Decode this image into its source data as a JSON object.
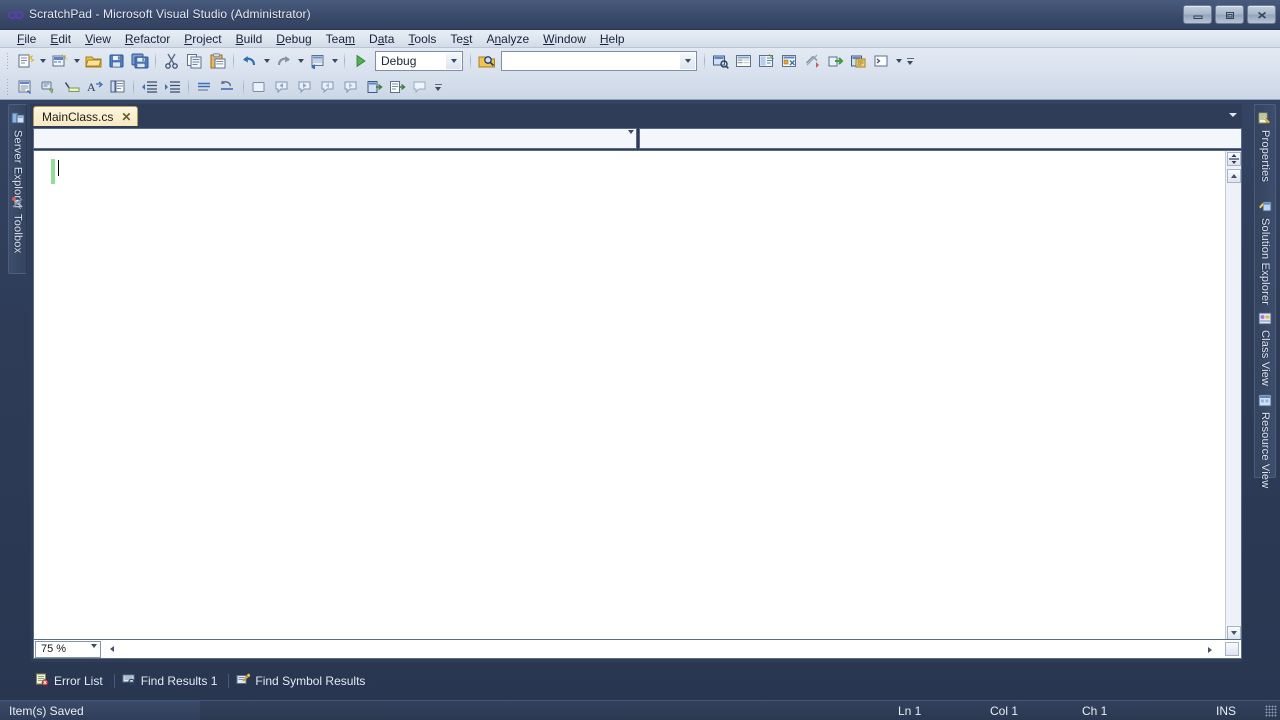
{
  "window": {
    "title": "ScratchPad - Microsoft Visual Studio (Administrator)",
    "app_icon": "visual-studio-icon",
    "controls": {
      "minimize": "Minimize",
      "restore": "Restore",
      "close": "Close"
    }
  },
  "menubar": {
    "items": [
      {
        "label": "File",
        "accel": "F"
      },
      {
        "label": "Edit",
        "accel": "E"
      },
      {
        "label": "View",
        "accel": "V"
      },
      {
        "label": "Refactor",
        "accel": "R"
      },
      {
        "label": "Project",
        "accel": "P"
      },
      {
        "label": "Build",
        "accel": "B"
      },
      {
        "label": "Debug",
        "accel": "D"
      },
      {
        "label": "Team",
        "accel": "m"
      },
      {
        "label": "Data",
        "accel": "a"
      },
      {
        "label": "Tools",
        "accel": "T"
      },
      {
        "label": "Test",
        "accel": "s"
      },
      {
        "label": "Analyze",
        "accel": "n"
      },
      {
        "label": "Window",
        "accel": "W"
      },
      {
        "label": "Help",
        "accel": "H"
      }
    ]
  },
  "toolbars": {
    "standard": {
      "buttons": [
        "new-project-icon",
        "new-item-icon",
        "open-file-icon",
        "save-icon",
        "save-all-icon",
        "cut-icon",
        "copy-icon",
        "paste-icon",
        "undo-icon",
        "redo-icon",
        "navigate-backward-icon"
      ],
      "start_debugging_icon": "start-debugging-play-icon",
      "solution_config": {
        "value": "Debug",
        "placeholder": "Debug"
      },
      "solution_platform": {
        "value": "",
        "placeholder": ""
      },
      "find_in_files_icon": "find-in-files-icon",
      "right_buttons": [
        "solution-explorer-icon",
        "properties-window-icon",
        "object-browser-icon",
        "toolbox-icon",
        "error-list-icon",
        "start-page-icon",
        "extension-manager-icon",
        "command-window-icon"
      ]
    },
    "text_editor": {
      "buttons": [
        "display-object-member-list-icon",
        "display-parameter-info-icon",
        "display-quick-info-icon",
        "display-word-completion-icon",
        "toggle-outlining-icon",
        "decrease-indent-icon",
        "increase-indent-icon",
        "comment-selection-icon",
        "uncomment-selection-icon",
        "toggle-bookmark-icon",
        "previous-bookmark-icon",
        "next-bookmark-icon",
        "previous-bookmark-folder-icon",
        "next-bookmark-folder-icon",
        "clear-bookmarks-icon",
        "toggle-all-bookmarks-icon",
        "bookmark-window-icon"
      ]
    }
  },
  "left_dock": {
    "tabs": [
      {
        "label": "Server Explorer",
        "icon": "server-explorer-icon"
      },
      {
        "label": "Toolbox",
        "icon": "toolbox-icon"
      }
    ]
  },
  "right_dock": {
    "tabs": [
      {
        "label": "Properties",
        "icon": "properties-icon"
      },
      {
        "label": "Solution Explorer",
        "icon": "solution-explorer-icon"
      },
      {
        "label": "Class View",
        "icon": "class-view-icon"
      },
      {
        "label": "Resource View",
        "icon": "resource-view-icon"
      }
    ]
  },
  "editor": {
    "tabs": [
      {
        "label": "MainClass.cs",
        "close": "✕",
        "active": true
      }
    ],
    "tab_list_icon": "tab-list-dropdown-icon",
    "navigation_bar": {
      "type_dropdown": {
        "value": "",
        "placeholder": ""
      },
      "member_dropdown": {
        "value": "",
        "placeholder": ""
      }
    },
    "content": "",
    "change_indicator": "unsaved-change-bar",
    "zoom": {
      "value": "75 %",
      "placeholder": "75 %"
    }
  },
  "bottom_tabs": [
    {
      "label": "Error List",
      "icon": "error-list-icon"
    },
    {
      "label": "Find Results 1",
      "icon": "find-results-icon"
    },
    {
      "label": "Find Symbol Results",
      "icon": "find-symbol-results-icon"
    }
  ],
  "statusbar": {
    "message": "Item(s) Saved",
    "line": "Ln 1",
    "column": "Col 1",
    "character": "Ch 1",
    "insert_mode": "INS"
  },
  "colors": {
    "chrome": "#2f3d59",
    "titlebar": "#3b4c6d",
    "menubar": "#dde5ef",
    "toolbar": "#d8e1ed",
    "active_tab": "#f7e9c0",
    "editor_background": "#ffffff",
    "change_bar_green": "#8fe096",
    "status_text": "#e7eef8"
  }
}
